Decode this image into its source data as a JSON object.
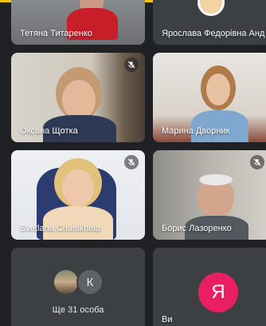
{
  "participants": [
    {
      "name": "Тетяна Титаренко",
      "muted": false
    },
    {
      "name": "Ярослава Федорівна Анд",
      "muted": false
    },
    {
      "name": "Оксана Щотка",
      "muted": true
    },
    {
      "name": "Марина Дворник",
      "muted": false
    },
    {
      "name": "Svetlana Chunikhina",
      "muted": true
    },
    {
      "name": "Борис Лазоренко",
      "muted": true
    }
  ],
  "overflow": {
    "label": "Ще 31 особа",
    "avatar_letter": "К"
  },
  "self_tile": {
    "name": "Ви",
    "avatar_letter": "Я",
    "avatar_color": "#e91e63"
  },
  "icons": {
    "muted": "mic-off-icon"
  }
}
